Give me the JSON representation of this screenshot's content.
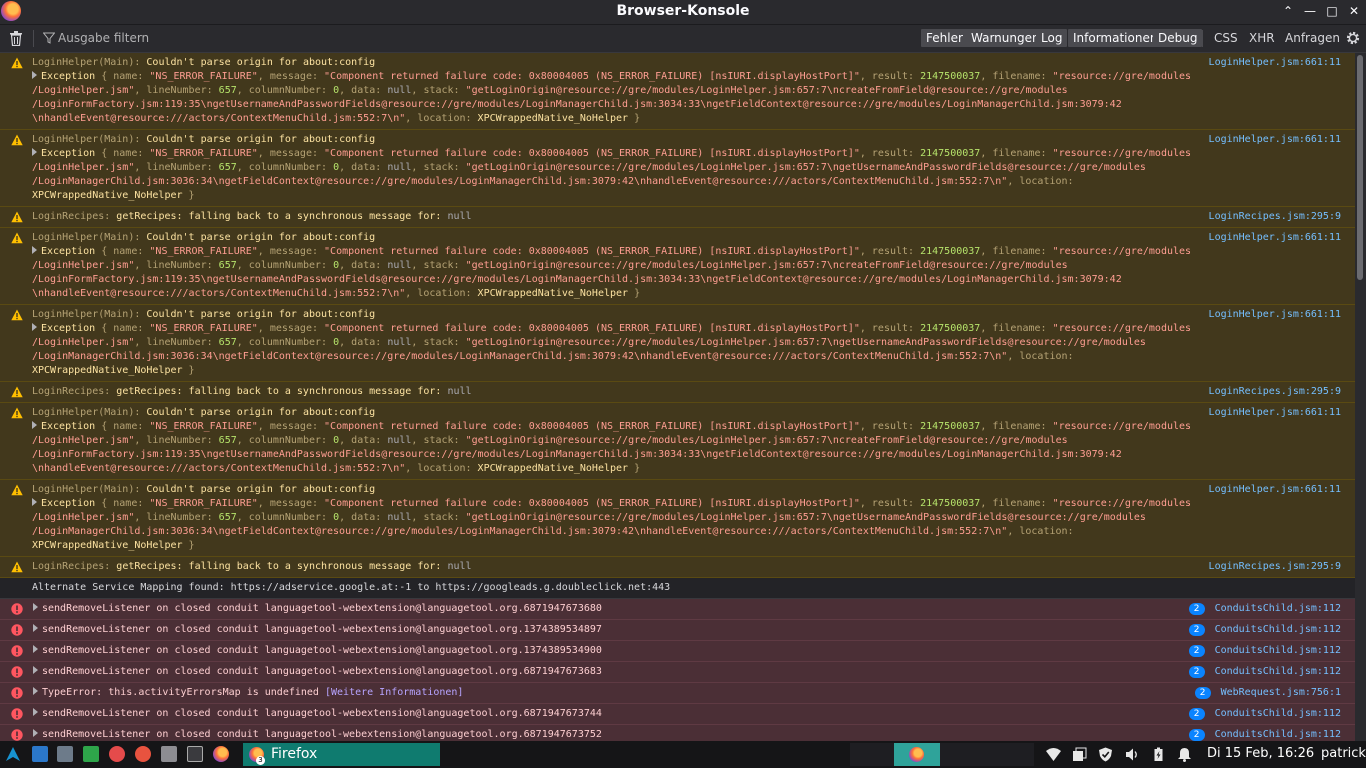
{
  "window": {
    "title": "Browser-Konsole"
  },
  "toolbar": {
    "filter_placeholder": "Ausgabe filtern",
    "levels": [
      "Fehler",
      "Warnungen",
      "Log",
      "Informationen",
      "Debug"
    ],
    "categories": [
      "CSS",
      "XHR",
      "Anfragen"
    ]
  },
  "messages": [
    {
      "kind": "warn",
      "origin": "LoginHelper(Main)",
      "text": "Couldn't parse origin for about:config",
      "detail": "factory_119",
      "source": "LoginHelper.jsm:661:11"
    },
    {
      "kind": "warn",
      "origin": "LoginHelper(Main)",
      "text": "Couldn't parse origin for about:config",
      "detail": "child_3036",
      "source": "LoginHelper.jsm:661:11"
    },
    {
      "kind": "recipe",
      "origin": "LoginRecipes",
      "text": "getRecipes: falling back to a synchronous message for:",
      "value": "null",
      "source": "LoginRecipes.jsm:295:9"
    },
    {
      "kind": "warn",
      "origin": "LoginHelper(Main)",
      "text": "Couldn't parse origin for about:config",
      "detail": "factory_119",
      "source": "LoginHelper.jsm:661:11"
    },
    {
      "kind": "warn",
      "origin": "LoginHelper(Main)",
      "text": "Couldn't parse origin for about:config",
      "detail": "child_3036",
      "source": "LoginHelper.jsm:661:11"
    },
    {
      "kind": "recipe",
      "origin": "LoginRecipes",
      "text": "getRecipes: falling back to a synchronous message for:",
      "value": "null",
      "source": "LoginRecipes.jsm:295:9"
    },
    {
      "kind": "warn",
      "origin": "LoginHelper(Main)",
      "text": "Couldn't parse origin for about:config",
      "detail": "factory_119",
      "source": "LoginHelper.jsm:661:11"
    },
    {
      "kind": "warn",
      "origin": "LoginHelper(Main)",
      "text": "Couldn't parse origin for about:config",
      "detail": "child_3036",
      "source": "LoginHelper.jsm:661:11"
    },
    {
      "kind": "recipe",
      "origin": "LoginRecipes",
      "text": "getRecipes: falling back to a synchronous message for:",
      "value": "null",
      "source": "LoginRecipes.jsm:295:9"
    },
    {
      "kind": "plain",
      "text": "Alternate Service Mapping found: https://adservice.google.at:-1 to https://googleads.g.doubleclick.net:443"
    },
    {
      "kind": "err",
      "text": "sendRemoveListener on closed conduit languagetool-webextension@languagetool.org.6871947673680",
      "count": "2",
      "source": "ConduitsChild.jsm:112"
    },
    {
      "kind": "err",
      "text": "sendRemoveListener on closed conduit languagetool-webextension@languagetool.org.1374389534897",
      "count": "2",
      "source": "ConduitsChild.jsm:112"
    },
    {
      "kind": "err",
      "text": "sendRemoveListener on closed conduit languagetool-webextension@languagetool.org.1374389534900",
      "count": "2",
      "source": "ConduitsChild.jsm:112"
    },
    {
      "kind": "err",
      "text": "sendRemoveListener on closed conduit languagetool-webextension@languagetool.org.6871947673683",
      "count": "2",
      "source": "ConduitsChild.jsm:112"
    },
    {
      "kind": "err",
      "text": "TypeError: this.activityErrorsMap is undefined",
      "link": "[Weitere Informationen]",
      "count": "2",
      "source": "WebRequest.jsm:756:1"
    },
    {
      "kind": "err",
      "text": "sendRemoveListener on closed conduit languagetool-webextension@languagetool.org.6871947673744",
      "count": "2",
      "source": "ConduitsChild.jsm:112"
    },
    {
      "kind": "err",
      "text": "sendRemoveListener on closed conduit languagetool-webextension@languagetool.org.6871947673752",
      "count": "2",
      "source": "ConduitsChild.jsm:112"
    }
  ],
  "exception": {
    "prefix": "Exception",
    "name_key": "name:",
    "name_val": "\"NS_ERROR_FAILURE\"",
    "message_key": "message:",
    "message_val": "\"Component returned failure code: 0x80004005 (NS_ERROR_FAILURE) [nsIURI.displayHostPort]\"",
    "result_key": "result:",
    "result_val": "2147500037",
    "filename_key": "filename:",
    "filename_val_a": "\"resource://gre/modules",
    "filename_val_b": "/LoginHelper.jsm\"",
    "line_key": "lineNumber:",
    "line_val": "657",
    "col_key": "columnNumber:",
    "col_val": "0",
    "data_key": "data:",
    "data_val": "null",
    "stack_key": "stack:",
    "stack_a_head": "\"getLoginOrigin@resource://gre/modules/LoginHelper.jsm:657:7\\ncreateFromField@resource://gre/modules",
    "stack_a_mid": "/LoginFormFactory.jsm:119:35\\ngetUsernameAndPasswordFields@resource://gre/modules/LoginManagerChild.jsm:3034:33\\ngetFieldContext@resource://gre/modules/LoginManagerChild.jsm:3079:42",
    "stack_a_tail": "\\nhandleEvent@resource:///actors/ContextMenuChild.jsm:552:7\\n\"",
    "stack_b_head": "\"getLoginOrigin@resource://gre/modules/LoginHelper.jsm:657:7\\ngetUsernameAndPasswordFields@resource://gre/modules",
    "stack_b_mid": "/LoginManagerChild.jsm:3036:34\\ngetFieldContext@resource://gre/modules/LoginManagerChild.jsm:3079:42\\nhandleEvent@resource:///actors/ContextMenuChild.jsm:552:7\\n\"",
    "location_key": "location:",
    "location_val": "XPCWrappedNative_NoHelper",
    "close": "}"
  },
  "taskbar": {
    "task_label": "Firefox",
    "task_count": "3",
    "clock": "Di 15 Feb, 16:26",
    "user": "patrick"
  }
}
